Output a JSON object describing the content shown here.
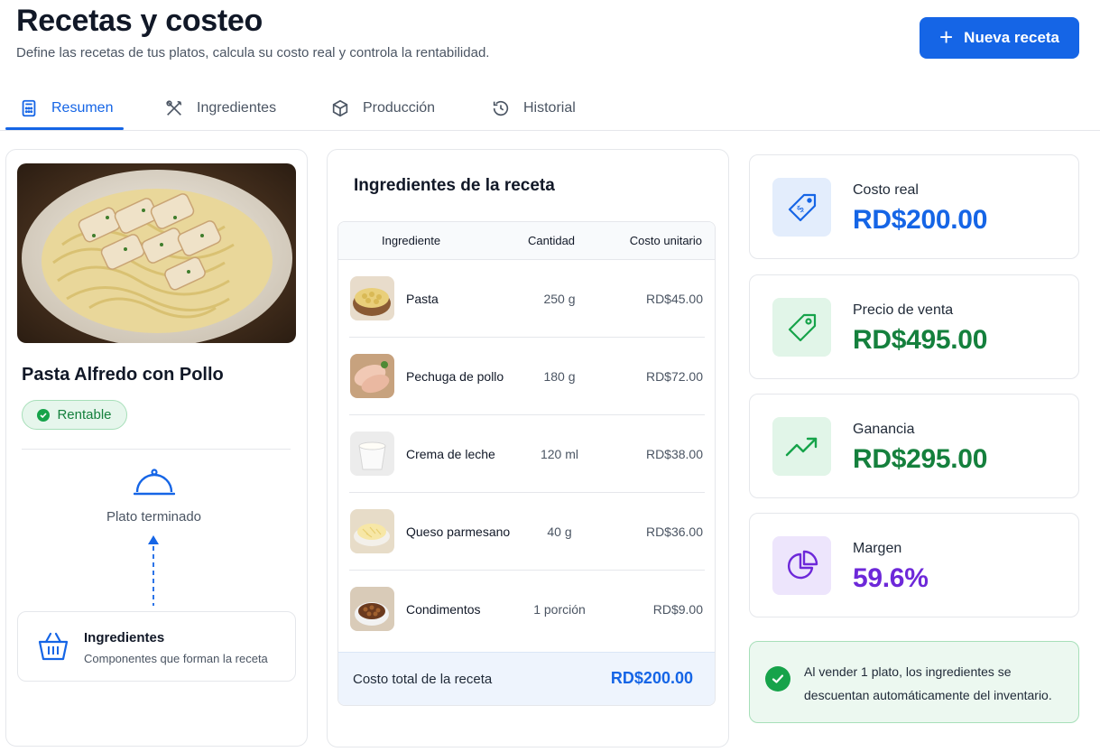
{
  "header": {
    "title": "Recetas y costeo",
    "subtitle": "Define las recetas de tus platos, calcula su costo real y controla la rentabilidad.",
    "new_button": "Nueva receta"
  },
  "tabs": [
    {
      "label": "Resumen",
      "icon": "calculator-icon",
      "active": true
    },
    {
      "label": "Ingredientes",
      "icon": "utensils-icon",
      "active": false
    },
    {
      "label": "Producción",
      "icon": "box-icon",
      "active": false
    },
    {
      "label": "Historial",
      "icon": "history-icon",
      "active": false
    }
  ],
  "recipe": {
    "name": "Pasta Alfredo con Pollo",
    "status": "Rentable",
    "flow_top": "Plato terminado",
    "flow_bottom_title": "Ingredientes",
    "flow_bottom_desc": "Componentes que forman la receta"
  },
  "ingredients_table": {
    "title": "Ingredientes de la receta",
    "columns": [
      "Ingrediente",
      "Cantidad",
      "Costo unitario"
    ],
    "rows": [
      {
        "name": "Pasta",
        "qty": "250 g",
        "cost": "RD$45.00"
      },
      {
        "name": "Pechuga de pollo",
        "qty": "180 g",
        "cost": "RD$72.00"
      },
      {
        "name": "Crema de leche",
        "qty": "120 ml",
        "cost": "RD$38.00"
      },
      {
        "name": "Queso parmesano",
        "qty": "40 g",
        "cost": "RD$36.00"
      },
      {
        "name": "Condimentos",
        "qty": "1 porción",
        "cost": "RD$9.00"
      }
    ],
    "total_label": "Costo total de la receta",
    "total_value": "RD$200.00"
  },
  "stats": [
    {
      "label": "Costo real",
      "value": "RD$200.00",
      "color": "#1565e6",
      "icon": "price-tag-dollar-icon"
    },
    {
      "label": "Precio de venta",
      "value": "RD$495.00",
      "color": "#15803d",
      "icon": "tag-icon"
    },
    {
      "label": "Ganancia",
      "value": "RD$295.00",
      "color": "#15803d",
      "icon": "trending-up-icon"
    },
    {
      "label": "Margen",
      "value": "59.6%",
      "color": "#6d28d9",
      "icon": "pie-chart-icon"
    }
  ],
  "notice": "Al vender 1 plato, los ingredientes se descuentan automáticamente del inventario.",
  "colors": {
    "primary": "#1565e6",
    "success": "#16a34a",
    "purple": "#6d28d9"
  }
}
